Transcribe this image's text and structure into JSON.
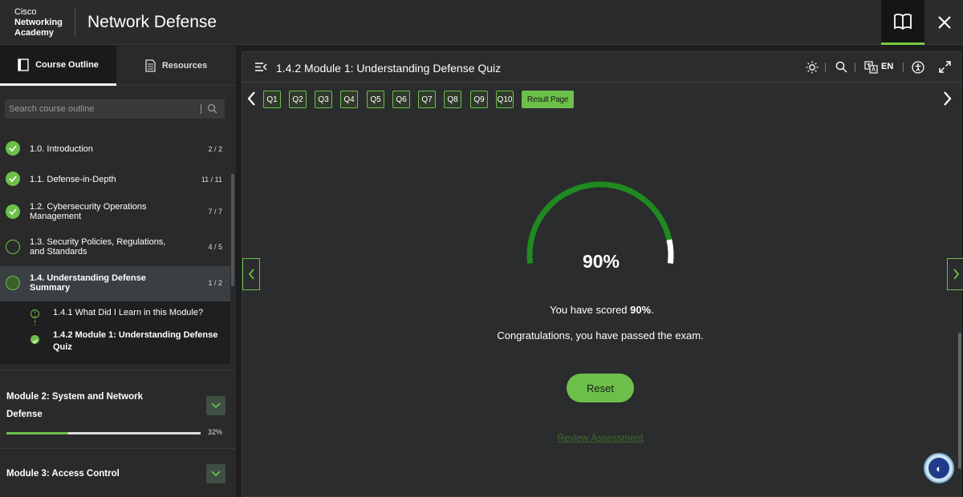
{
  "header": {
    "brand_line1": "Cisco",
    "brand_line2": "Networking",
    "brand_line3": "Academy",
    "course_title": "Network Defense",
    "book_icon": "book-icon",
    "close_icon": "close-icon"
  },
  "sidebar": {
    "tabs": [
      {
        "label": "Course Outline",
        "icon": "outline-icon"
      },
      {
        "label": "Resources",
        "icon": "document-icon"
      }
    ],
    "search_placeholder": "Search course outline",
    "items": [
      {
        "label": "1.0. Introduction",
        "count": "2 / 2",
        "status": "done"
      },
      {
        "label": "1.1. Defense-in-Depth",
        "count": "11 / 11",
        "status": "done"
      },
      {
        "label": "1.2. Cybersecurity Operations Management",
        "count": "7 / 7",
        "status": "done"
      },
      {
        "label": "1.3. Security Policies, Regulations, and Standards",
        "count": "4 / 5",
        "status": "open"
      },
      {
        "label": "1.4. Understanding Defense Summary",
        "count": "1 / 2",
        "status": "current"
      }
    ],
    "subitems": [
      {
        "label": "1.4.1 What Did I Learn in this Module?",
        "status": "open"
      },
      {
        "label": "1.4.2 Module 1: Understanding Defense Quiz",
        "status": "done"
      }
    ],
    "modules": [
      {
        "title": "Module 2: System and Network Defense",
        "progress_label": "32%",
        "progress": 32
      },
      {
        "title": "Module 3: Access Control"
      }
    ]
  },
  "main": {
    "page_title": "1.4.2 Module 1: Understanding Defense Quiz",
    "lang": "EN",
    "questions": [
      "Q1",
      "Q2",
      "Q3",
      "Q4",
      "Q5",
      "Q6",
      "Q7",
      "Q8",
      "Q9",
      "Q10"
    ],
    "result_label": "Result Page",
    "score_big": "90%",
    "score_prefix": "You have scored ",
    "score_value": "90%",
    "score_suffix": ".",
    "congrats": "Congratulations, you have passed the exam.",
    "reset_label": "Reset",
    "review_label": "Review Assessment",
    "score_fraction": 0.9
  },
  "colors": {
    "accent": "#6cc04a",
    "background": "#1e1e1e",
    "panel": "#2b2c2e"
  }
}
